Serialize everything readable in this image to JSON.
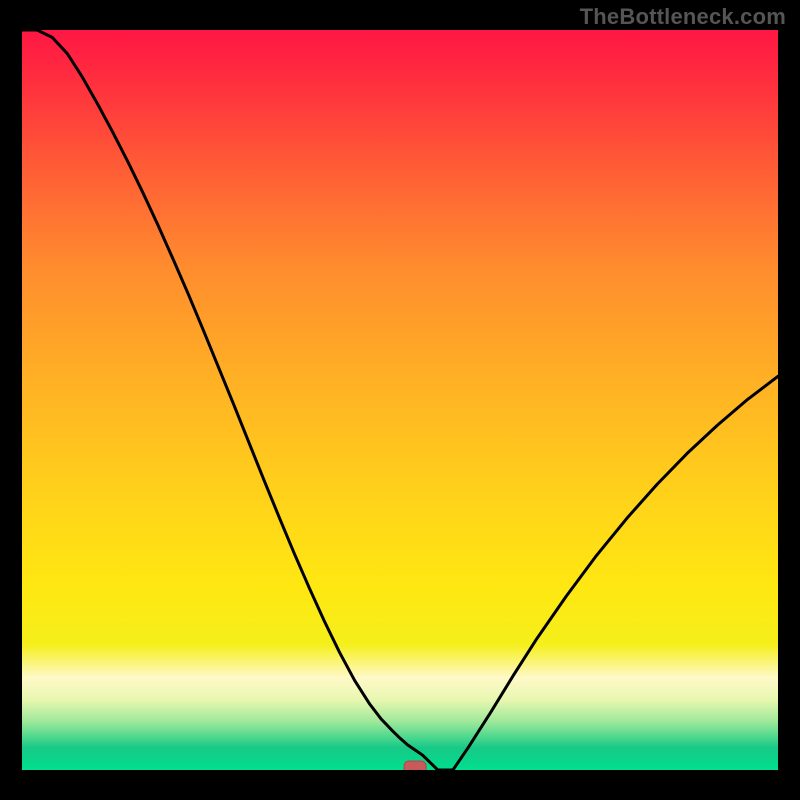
{
  "watermark": "TheBottleneck.com",
  "colors": {
    "bg": "#000000",
    "curve": "#000000",
    "marker_fill": "#c85a5a",
    "marker_stroke": "#b04646",
    "grad_stops": [
      {
        "offset": 0.0,
        "color": "#ff1744"
      },
      {
        "offset": 0.06,
        "color": "#ff2b3f"
      },
      {
        "offset": 0.18,
        "color": "#ff5a36"
      },
      {
        "offset": 0.32,
        "color": "#ff8c2e"
      },
      {
        "offset": 0.48,
        "color": "#ffb224"
      },
      {
        "offset": 0.63,
        "color": "#ffd21a"
      },
      {
        "offset": 0.75,
        "color": "#ffe712"
      },
      {
        "offset": 0.83,
        "color": "#f5ef1a"
      },
      {
        "offset": 0.875,
        "color": "#fff9c8"
      },
      {
        "offset": 0.905,
        "color": "#e8f7b0"
      },
      {
        "offset": 0.935,
        "color": "#9de89a"
      },
      {
        "offset": 0.955,
        "color": "#4fd88e"
      },
      {
        "offset": 0.97,
        "color": "#17c987"
      },
      {
        "offset": 1.0,
        "color": "#00e08e"
      }
    ]
  },
  "chart_data": {
    "type": "line",
    "title": "",
    "xlabel": "",
    "ylabel": "",
    "xlim": [
      0,
      100
    ],
    "ylim": [
      0,
      100
    ],
    "grid": false,
    "marker": {
      "x": 52,
      "y": 0
    },
    "x": [
      0,
      2,
      4,
      6,
      8,
      10,
      12,
      14,
      16,
      18,
      20,
      22,
      24,
      26,
      28,
      30,
      32,
      34,
      36,
      38,
      40,
      42,
      44,
      46,
      47.5,
      49,
      50,
      51,
      52,
      53,
      55,
      57,
      59,
      62,
      65,
      68,
      72,
      76,
      80,
      84,
      88,
      92,
      96,
      100
    ],
    "values": [
      100,
      100,
      99,
      96.8,
      93.6,
      90,
      86.2,
      82.2,
      78,
      73.6,
      69,
      64.3,
      59.4,
      54.4,
      49.4,
      44.3,
      39.2,
      34.2,
      29.3,
      24.6,
      20.1,
      15.9,
      12.1,
      8.9,
      6.9,
      5.3,
      4.3,
      3.4,
      2.7,
      2.0,
      0.0,
      0.0,
      3.0,
      7.8,
      12.8,
      17.6,
      23.5,
      29.0,
      34.0,
      38.6,
      42.8,
      46.6,
      50.1,
      53.2
    ],
    "annotation": "V-shaped bottleneck curve on heat-map gradient; minimum (optimal balance) occurs at x≈52. Left branch starts at y=100, right branch climbs to y≈53 at x=100."
  }
}
